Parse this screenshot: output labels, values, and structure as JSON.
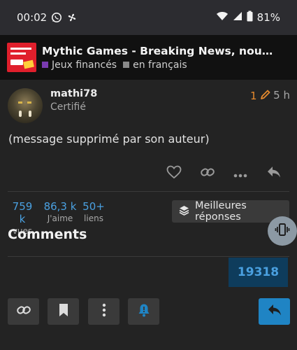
{
  "status_bar": {
    "time": "00:02",
    "battery": "81%"
  },
  "topic": {
    "title": "Mythic Games - Breaking News, nouvelle s...",
    "categories": [
      {
        "label": "Jeux financés",
        "color": "#7a3bb0"
      },
      {
        "label": "en français",
        "color": "#8a8a8a"
      }
    ]
  },
  "post": {
    "username": "mathi78",
    "user_title": "Certifié",
    "edit_count": "1",
    "age": "5 h",
    "body": "(message supprimé par son auteur)"
  },
  "stats": {
    "views": {
      "value": "759 k",
      "label": "vues"
    },
    "likes": {
      "value": "86,3 k",
      "label": "J'aime"
    },
    "links": {
      "value": "50+",
      "label": "liens"
    }
  },
  "best_replies_label": "Meilleures réponses",
  "comments_title": "Comments",
  "post_number_badge": "19318",
  "colors": {
    "accent": "#1f84c4",
    "link": "#4aa0e0",
    "edit": "#e58a2e",
    "background": "#232323"
  },
  "icons": {
    "status": [
      "whatsapp-icon",
      "fan-icon",
      "wifi-icon",
      "signal-icon",
      "battery-icon"
    ],
    "post_actions": [
      "heart-icon",
      "link-icon",
      "more-icon",
      "reply-icon"
    ],
    "bottom": [
      "link-icon",
      "bookmark-icon",
      "more-vertical-icon",
      "bell-icon",
      "reply-icon"
    ]
  }
}
